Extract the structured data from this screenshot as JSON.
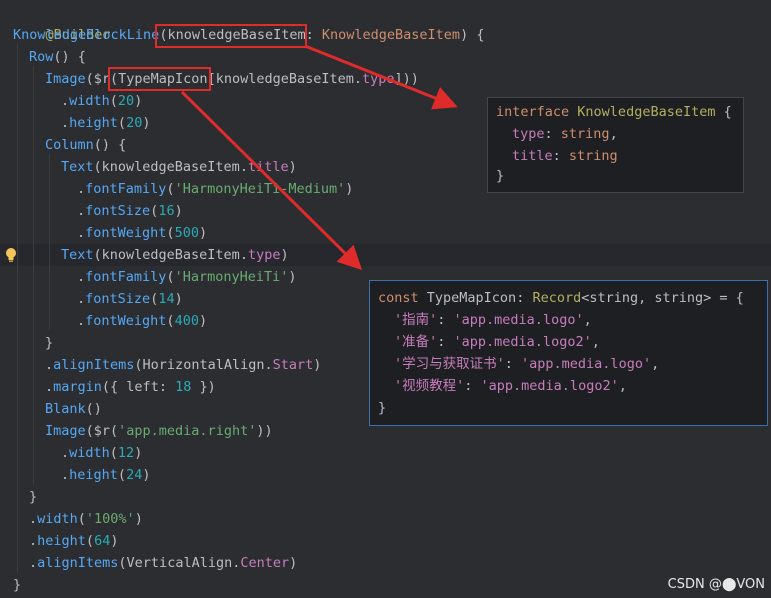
{
  "code": {
    "line1": {
      "ann": "@Builder"
    },
    "line2": {
      "fn": "KnowledgeBlockLine",
      "open": "(",
      "param": "knowledgeBaseItem",
      "colon": ": ",
      "type": "KnowledgeBaseItem",
      "close": ") {"
    },
    "line3": {
      "comp": "Row",
      "rest": "() {"
    },
    "line4": {
      "comp": "Image",
      "a": "($r(",
      "map": "TypeMapIcon",
      "b": "[knowledgeBaseItem.",
      "prop": "type",
      "c": "]))"
    },
    "line5": {
      "prefix": ".",
      "fn": "width",
      "open": "(",
      "num": "20",
      "close": ")"
    },
    "line6": {
      "prefix": ".",
      "fn": "height",
      "open": "(",
      "num": "20",
      "close": ")"
    },
    "line7": {
      "comp": "Column",
      "rest": "() {"
    },
    "line8": {
      "comp": "Text",
      "a": "(knowledgeBaseItem.",
      "prop": "title",
      "b": ")"
    },
    "line9": {
      "prefix": ".",
      "fn": "fontFamily",
      "open": "(",
      "str": "'HarmonyHeiTi-Medium'",
      "close": ")"
    },
    "line10": {
      "prefix": ".",
      "fn": "fontSize",
      "open": "(",
      "num": "16",
      "close": ")"
    },
    "line11": {
      "prefix": ".",
      "fn": "fontWeight",
      "open": "(",
      "num": "500",
      "close": ")"
    },
    "line12": {
      "comp": "Text",
      "a": "(knowledgeBaseItem.",
      "prop": "type",
      "b": ")"
    },
    "line13": {
      "prefix": ".",
      "fn": "fontFamily",
      "open": "(",
      "str": "'HarmonyHeiTi'",
      "close": ")"
    },
    "line14": {
      "prefix": ".",
      "fn": "fontSize",
      "open": "(",
      "num": "14",
      "close": ")"
    },
    "line15": {
      "prefix": ".",
      "fn": "fontWeight",
      "open": "(",
      "num": "400",
      "close": ")"
    },
    "line16": {
      "text": "}"
    },
    "line17": {
      "prefix": ".",
      "fn": "alignItems",
      "open": "(HorizontalAlign.",
      "enum": "Start",
      "close": ")"
    },
    "line18": {
      "prefix": ".",
      "fn": "margin",
      "open": "({ left: ",
      "num": "18",
      "close": " })"
    },
    "line19": {
      "comp": "Blank",
      "rest": "()"
    },
    "line20": {
      "comp": "Image",
      "a": "($r(",
      "str": "'app.media.right'",
      "b": "))"
    },
    "line21": {
      "prefix": ".",
      "fn": "width",
      "open": "(",
      "num": "12",
      "close": ")"
    },
    "line22": {
      "prefix": ".",
      "fn": "height",
      "open": "(",
      "num": "24",
      "close": ")"
    },
    "line23": {
      "text": "}"
    },
    "line24": {
      "prefix": ".",
      "fn": "width",
      "open": "(",
      "str": "'100%'",
      "close": ")"
    },
    "line25": {
      "prefix": ".",
      "fn": "height",
      "open": "(",
      "num": "64",
      "close": ")"
    },
    "line26": {
      "prefix": ".",
      "fn": "alignItems",
      "open": "(VerticalAlign.",
      "enum": "Center",
      "close": ")"
    },
    "line27": {
      "text": "}"
    }
  },
  "popup_interface": {
    "l1_kw": "interface",
    "l1_name": "KnowledgeBaseItem",
    "l1_brace": " {",
    "l2_key": "type",
    "l2_colon": ": ",
    "l2_type": "string",
    "l2_comma": ",",
    "l3_key": "title",
    "l3_colon": ": ",
    "l3_type": "string",
    "l4": "}"
  },
  "popup_const": {
    "l1_kw": "const",
    "l1_name": "TypeMapIcon",
    "l1_colon": ": ",
    "l1_type": "Record",
    "l1_generic": "<string, string>",
    "l1_eq": " = {",
    "entries": [
      {
        "key": "'指南'",
        "sep": ": ",
        "val": "'app.media.logo'",
        "end": ","
      },
      {
        "key": "'准备'",
        "sep": ": ",
        "val": "'app.media.logo2'",
        "end": ","
      },
      {
        "key": "'学习与获取证书'",
        "sep": ": ",
        "val": "'app.media.logo'",
        "end": ","
      },
      {
        "key": "'视频教程'",
        "sep": ": ",
        "val": "'app.media.logo2'",
        "end": ","
      }
    ],
    "l6": "}"
  },
  "watermark": "CSDN @⬤VON",
  "colors": {
    "annotation_box": "#e02b2b",
    "arrow": "#e02b2b",
    "popup_focus_border": "#3d6fa8"
  }
}
